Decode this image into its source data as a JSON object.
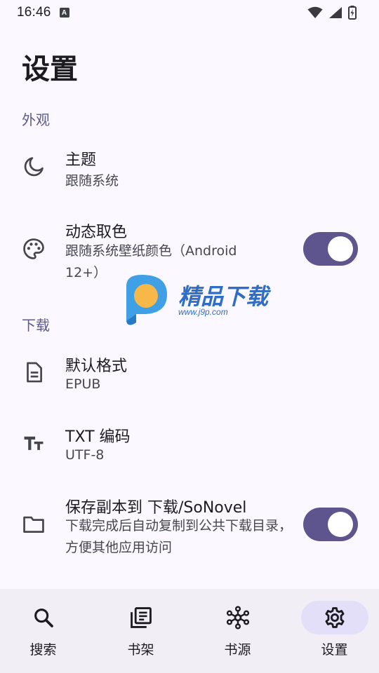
{
  "status_bar": {
    "time": "16:46",
    "notification_letter": "A"
  },
  "page": {
    "title": "设置"
  },
  "sections": {
    "appearance": {
      "header": "外观",
      "theme": {
        "title": "主题",
        "subtitle": "跟随系统",
        "icon": "moon-icon"
      },
      "dynamic_color": {
        "title": "动态取色",
        "subtitle": "跟随系统壁纸颜色（Android 12+）",
        "icon": "palette-icon",
        "enabled": true
      }
    },
    "download": {
      "header": "下载",
      "default_format": {
        "title": "默认格式",
        "subtitle": "EPUB",
        "icon": "document-icon"
      },
      "txt_encoding": {
        "title": "TXT 编码",
        "subtitle": "UTF-8",
        "icon": "text-size-icon"
      },
      "save_copy": {
        "title": "保存副本到 下载/SoNovel",
        "subtitle": "下载完成后自动复制到公共下载目录，方便其他应用访问",
        "icon": "folder-icon",
        "enabled": true
      }
    }
  },
  "bottom_nav": {
    "items": [
      {
        "label": "搜索",
        "icon": "search-icon",
        "active": false
      },
      {
        "label": "书架",
        "icon": "library-icon",
        "active": false
      },
      {
        "label": "书源",
        "icon": "hub-icon",
        "active": false
      },
      {
        "label": "设置",
        "icon": "gear-icon",
        "active": true
      }
    ]
  },
  "watermark": {
    "brand": "精品下载",
    "url": "www.j9p.com"
  },
  "colors": {
    "background": "#fcf8ff",
    "accent": "#5e548e",
    "section_header": "#5d5a8e",
    "nav_background": "#f2eef6",
    "nav_active_pill": "#e4dff8"
  }
}
